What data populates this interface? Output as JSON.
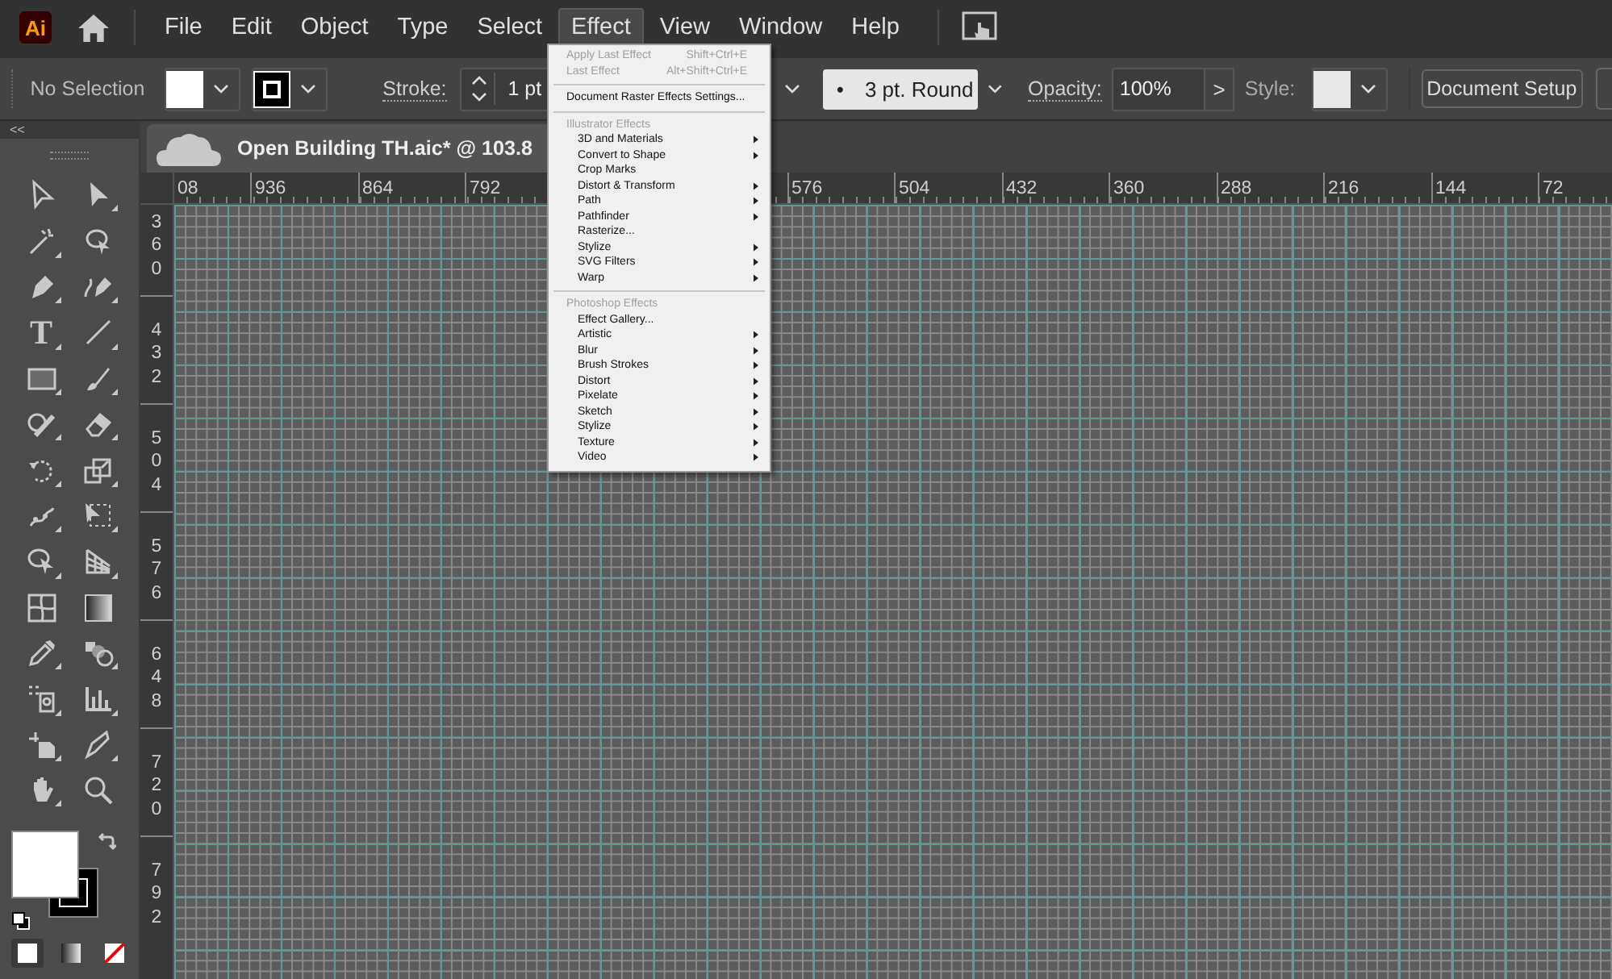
{
  "app_badge": "Ai",
  "menu_bar": [
    {
      "label": "File",
      "selected": false
    },
    {
      "label": "Edit",
      "selected": false
    },
    {
      "label": "Object",
      "selected": false
    },
    {
      "label": "Type",
      "selected": false
    },
    {
      "label": "Select",
      "selected": false
    },
    {
      "label": "Effect",
      "selected": true
    },
    {
      "label": "View",
      "selected": false
    },
    {
      "label": "Window",
      "selected": false
    },
    {
      "label": "Help",
      "selected": false
    }
  ],
  "control_bar": {
    "selection": "No Selection",
    "stroke_label": "Stroke:",
    "stroke_weight": "1 pt",
    "brush_bullet": "•",
    "brush": "3 pt. Round",
    "opacity_label": "Opacity:",
    "opacity": "100%",
    "opacity_arrow": ">",
    "style_label": "Style:",
    "document_setup": "Document Setup"
  },
  "tools_panel": {
    "collapse": "<<",
    "type_tool_glyph": "T"
  },
  "document_tab": {
    "title": "Open Building TH.aic* @ 103.8"
  },
  "top_ruler": {
    "left_labels": [
      "08",
      "936",
      "864",
      "792"
    ],
    "right_labels": [
      "576",
      "504",
      "432",
      "360",
      "288",
      "216",
      "144",
      "72"
    ]
  },
  "left_ruler": {
    "labels": [
      "360",
      "432",
      "504",
      "576",
      "648",
      "720",
      "792"
    ]
  },
  "effect_menu": {
    "top": [
      {
        "label": "Apply Last Effect",
        "shortcut": "Shift+Ctrl+E",
        "disabled": true
      },
      {
        "label": "Last Effect",
        "shortcut": "Alt+Shift+Ctrl+E",
        "disabled": true
      }
    ],
    "settings": {
      "label": "Document Raster Effects Settings...",
      "disabled": false
    },
    "sections": [
      {
        "header": "Illustrator Effects",
        "items": [
          {
            "label": "3D and Materials",
            "submenu": true
          },
          {
            "label": "Convert to Shape",
            "submenu": true
          },
          {
            "label": "Crop Marks",
            "submenu": false
          },
          {
            "label": "Distort & Transform",
            "submenu": true
          },
          {
            "label": "Path",
            "submenu": true
          },
          {
            "label": "Pathfinder",
            "submenu": true
          },
          {
            "label": "Rasterize...",
            "submenu": false
          },
          {
            "label": "Stylize",
            "submenu": true
          },
          {
            "label": "SVG Filters",
            "submenu": true
          },
          {
            "label": "Warp",
            "submenu": true
          }
        ]
      },
      {
        "header": "Photoshop Effects",
        "items": [
          {
            "label": "Effect Gallery...",
            "submenu": false
          },
          {
            "label": "Artistic",
            "submenu": true
          },
          {
            "label": "Blur",
            "submenu": true
          },
          {
            "label": "Brush Strokes",
            "submenu": true
          },
          {
            "label": "Distort",
            "submenu": true
          },
          {
            "label": "Pixelate",
            "submenu": true
          },
          {
            "label": "Sketch",
            "submenu": true
          },
          {
            "label": "Stylize",
            "submenu": true
          },
          {
            "label": "Texture",
            "submenu": true
          },
          {
            "label": "Video",
            "submenu": true
          }
        ]
      }
    ]
  }
}
